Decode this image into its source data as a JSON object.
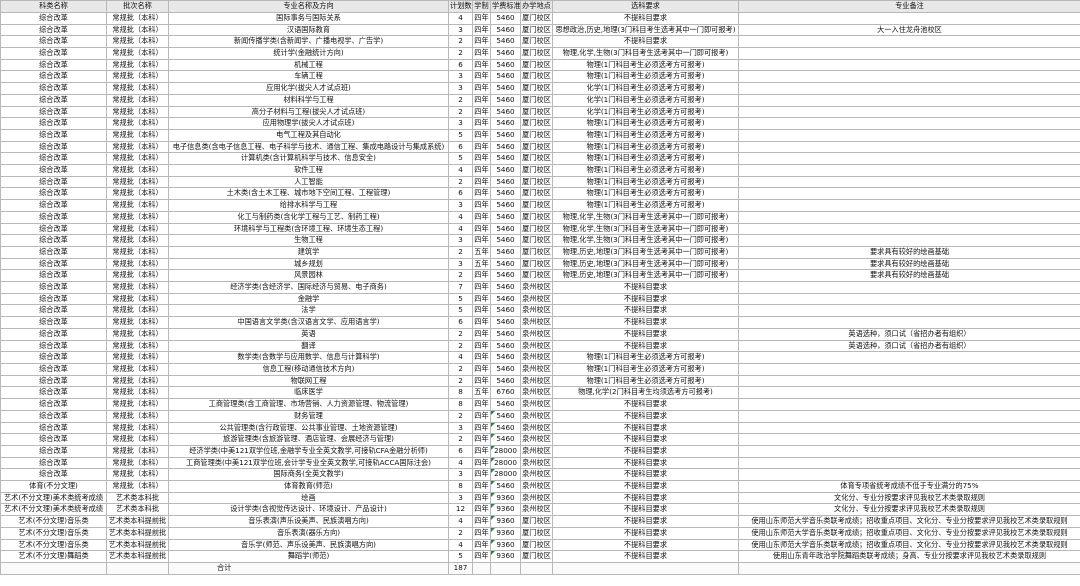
{
  "headers": [
    "科类名称",
    "批次名称",
    "专业名称及方向",
    "计划数",
    "学制",
    "学费标准",
    "办学地点",
    "选科要求",
    "专业备注"
  ],
  "rows": [
    [
      "综合改革",
      "常规批（本科）",
      "国际事务与国际关系",
      "4",
      "四年",
      "5460",
      "厦门校区",
      "不提科目要求",
      ""
    ],
    [
      "综合改革",
      "常规批（本科）",
      "汉语国际教育",
      "3",
      "四年",
      "5460",
      "厦门校区",
      "思想政治,历史,地理(3门科目考生选考其中一门即可报考)",
      "大一入住龙舟池校区"
    ],
    [
      "综合改革",
      "常规批（本科）",
      "新闻传播学类(含新闻学、广播电视学、广告学)",
      "2",
      "四年",
      "5460",
      "厦门校区",
      "不提科目要求",
      ""
    ],
    [
      "综合改革",
      "常规批（本科）",
      "统计学(金融统计方向)",
      "2",
      "四年",
      "5460",
      "厦门校区",
      "物理,化学,生物(3门科目考生选考其中一门即可报考)",
      ""
    ],
    [
      "综合改革",
      "常规批（本科）",
      "机械工程",
      "6",
      "四年",
      "5460",
      "厦门校区",
      "物理(1门科目考生必须选考方可报考)",
      ""
    ],
    [
      "综合改革",
      "常规批（本科）",
      "车辆工程",
      "3",
      "四年",
      "5460",
      "厦门校区",
      "物理(1门科目考生必须选考方可报考)",
      ""
    ],
    [
      "综合改革",
      "常规批（本科）",
      "应用化学(拔尖人才试点班)",
      "3",
      "四年",
      "5460",
      "厦门校区",
      "化学(1门科目考生必须选考方可报考)",
      ""
    ],
    [
      "综合改革",
      "常规批（本科）",
      "材料科学与工程",
      "2",
      "四年",
      "5460",
      "厦门校区",
      "化学(1门科目考生必须选考方可报考)",
      ""
    ],
    [
      "综合改革",
      "常规批（本科）",
      "高分子材料与工程(拔尖人才试点班)",
      "2",
      "四年",
      "5460",
      "厦门校区",
      "化学(1门科目考生必须选考方可报考)",
      ""
    ],
    [
      "综合改革",
      "常规批（本科）",
      "应用物理学(拔尖人才试点班)",
      "3",
      "四年",
      "5460",
      "厦门校区",
      "物理(1门科目考生必须选考方可报考)",
      ""
    ],
    [
      "综合改革",
      "常规批（本科）",
      "电气工程及其自动化",
      "5",
      "四年",
      "5460",
      "厦门校区",
      "物理(1门科目考生必须选考方可报考)",
      ""
    ],
    [
      "综合改革",
      "常规批（本科）",
      "电子信息类(含电子信息工程、电子科学与技术、通信工程、集成电路设计与集成系统)",
      "6",
      "四年",
      "5460",
      "厦门校区",
      "物理(1门科目考生必须选考方可报考)",
      ""
    ],
    [
      "综合改革",
      "常规批（本科）",
      "计算机类(含计算机科学与技术、信息安全)",
      "5",
      "四年",
      "5460",
      "厦门校区",
      "物理(1门科目考生必须选考方可报考)",
      ""
    ],
    [
      "综合改革",
      "常规批（本科）",
      "软件工程",
      "4",
      "四年",
      "5460",
      "厦门校区",
      "物理(1门科目考生必须选考方可报考)",
      ""
    ],
    [
      "综合改革",
      "常规批（本科）",
      "人工智能",
      "2",
      "四年",
      "5460",
      "厦门校区",
      "物理(1门科目考生必须选考方可报考)",
      ""
    ],
    [
      "综合改革",
      "常规批（本科）",
      "土木类(含土木工程、城市地下空间工程、工程管理)",
      "6",
      "四年",
      "5460",
      "厦门校区",
      "物理(1门科目考生必须选考方可报考)",
      ""
    ],
    [
      "综合改革",
      "常规批（本科）",
      "给排水科学与工程",
      "3",
      "四年",
      "5460",
      "厦门校区",
      "物理(1门科目考生必须选考方可报考)",
      ""
    ],
    [
      "综合改革",
      "常规批（本科）",
      "化工与制药类(含化学工程与工艺、制药工程)",
      "4",
      "四年",
      "5460",
      "厦门校区",
      "物理,化学,生物(3门科目考生选考其中一门即可报考)",
      ""
    ],
    [
      "综合改革",
      "常规批（本科）",
      "环境科学与工程类(含环境工程、环境生态工程)",
      "4",
      "四年",
      "5460",
      "厦门校区",
      "物理,化学,生物(3门科目考生选考其中一门即可报考)",
      ""
    ],
    [
      "综合改革",
      "常规批（本科）",
      "生物工程",
      "3",
      "四年",
      "5460",
      "厦门校区",
      "物理,化学,生物(3门科目考生选考其中一门即可报考)",
      ""
    ],
    [
      "综合改革",
      "常规批（本科）",
      "建筑学",
      "2",
      "五年",
      "5460",
      "厦门校区",
      "物理,历史,地理(3门科目考生选考其中一门即可报考)",
      "要求具有较好的绘画基础"
    ],
    [
      "综合改革",
      "常规批（本科）",
      "城乡规划",
      "3",
      "五年",
      "5460",
      "厦门校区",
      "物理,历史,地理(3门科目考生选考其中一门即可报考)",
      "要求具有较好的绘画基础"
    ],
    [
      "综合改革",
      "常规批（本科）",
      "风景园林",
      "2",
      "四年",
      "5460",
      "厦门校区",
      "物理,历史,地理(3门科目考生选考其中一门即可报考)",
      "要求具有较好的绘画基础"
    ],
    [
      "综合改革",
      "常规批（本科）",
      "经济学类(含经济学、国际经济与贸易、电子商务)",
      "7",
      "四年",
      "5460",
      "泉州校区",
      "不提科目要求",
      ""
    ],
    [
      "综合改革",
      "常规批（本科）",
      "金融学",
      "5",
      "四年",
      "5460",
      "泉州校区",
      "不提科目要求",
      ""
    ],
    [
      "综合改革",
      "常规批（本科）",
      "法学",
      "5",
      "四年",
      "5460",
      "泉州校区",
      "不提科目要求",
      ""
    ],
    [
      "综合改革",
      "常规批（本科）",
      "中国语言文学类(含汉语言文学、应用语言学)",
      "6",
      "四年",
      "5460",
      "泉州校区",
      "不提科目要求",
      ""
    ],
    [
      "综合改革",
      "常规批（本科）",
      "英语",
      "2",
      "四年",
      "5460",
      "泉州校区",
      "不提科目要求",
      "英语选种，须口试（省招办者有组织）"
    ],
    [
      "综合改革",
      "常规批（本科）",
      "翻译",
      "2",
      "四年",
      "5460",
      "泉州校区",
      "不提科目要求",
      "英语选种，须口试（省招办者有组织）"
    ],
    [
      "综合改革",
      "常规批（本科）",
      "数学类(含数学与应用数学、信息与计算科学)",
      "4",
      "四年",
      "5460",
      "泉州校区",
      "物理(1门科目考生必须选考方可报考)",
      ""
    ],
    [
      "综合改革",
      "常规批（本科）",
      "信息工程(移动通信技术方向)",
      "2",
      "四年",
      "5460",
      "泉州校区",
      "物理(1门科目考生必须选考方可报考)",
      ""
    ],
    [
      "综合改革",
      "常规批（本科）",
      "物联网工程",
      "2",
      "四年",
      "5460",
      "泉州校区",
      "物理(1门科目考生必须选考方可报考)",
      ""
    ],
    [
      "综合改革",
      "常规批（本科）",
      "临床医学",
      "8",
      "五年",
      "6760",
      "泉州校区",
      "物理,化学(2门科目考生均须选考方可报考)",
      ""
    ],
    [
      "综合改革",
      "常规批（本科）",
      "工商管理类(含工商管理、市场营销、人力资源管理、物流管理)",
      "8",
      "四年",
      "5460",
      "泉州校区",
      "不提科目要求",
      ""
    ],
    [
      "综合改革",
      "常规批（本科）",
      "财务管理",
      "2",
      "四年",
      "5460",
      "泉州校区",
      "不提科目要求",
      ""
    ],
    [
      "综合改革",
      "常规批（本科）",
      "公共管理类(含行政管理、公共事业管理、土地资源管理)",
      "3",
      "四年",
      "5460",
      "泉州校区",
      "不提科目要求",
      ""
    ],
    [
      "综合改革",
      "常规批（本科）",
      "旅游管理类(含旅游管理、酒店管理、会展经济与管理)",
      "2",
      "四年",
      "5460",
      "泉州校区",
      "不提科目要求",
      ""
    ],
    [
      "综合改革",
      "常规批（本科）",
      "经济学类(中美121双学位班,金融学专业全英文教学,可接轨CFA金融分析师)",
      "6",
      "四年",
      "28000",
      "泉州校区",
      "不提科目要求",
      ""
    ],
    [
      "综合改革",
      "常规批（本科）",
      "工商管理类(中美121双学位班,会计学专业全英文教学,可接轨ACCA国际注会)",
      "4",
      "四年",
      "28000",
      "泉州校区",
      "不提科目要求",
      ""
    ],
    [
      "综合改革",
      "常规批（本科）",
      "国际商务(全英文教学)",
      "3",
      "四年",
      "28000",
      "泉州校区",
      "不提科目要求",
      ""
    ],
    [
      "体育(不分文理)",
      "常规批（本科）",
      "体育教育(师范)",
      "8",
      "四年",
      "5460",
      "泉州校区",
      "不提科目要求",
      "体育专项省统考成绩不低于专业满分的75%"
    ],
    [
      "艺术(不分文理)美术类统考成绩",
      "艺术类本科批",
      "绘画",
      "3",
      "四年",
      "9360",
      "泉州校区",
      "不提科目要求",
      "文化分、专业分按要求评见我校艺术类录取规则"
    ],
    [
      "艺术(不分文理)美术类统考成绩",
      "艺术类本科批",
      "设计学类(含视觉传达设计、环境设计、产品设计)",
      "12",
      "四年",
      "9360",
      "泉州校区",
      "不提科目要求",
      "文化分、专业分按要求评见我校艺术类录取规则"
    ],
    [
      "艺术(不分文理)音乐类",
      "艺术类本科提前批",
      "音乐表演(声乐设美声、民族演唱方向)",
      "4",
      "四年",
      "9360",
      "厦门校区",
      "不提科目要求",
      "使用山东师范大学音乐类联考成绩；招收重点项目、文化分、专业分按要求评见我校艺术类录取规则"
    ],
    [
      "艺术(不分文理)音乐类",
      "艺术类本科提前批",
      "音乐表演(器乐方向)",
      "2",
      "四年",
      "9360",
      "厦门校区",
      "不提科目要求",
      "使用山东师范大学音乐类联考成绩；招收重点项目、文化分、专业分按要求评见我校艺术类录取规则"
    ],
    [
      "艺术(不分文理)音乐类",
      "艺术类本科提前批",
      "音乐学(师范、声乐设美声、民族演唱方向)",
      "4",
      "四年",
      "9360",
      "厦门校区",
      "不提科目要求",
      "使用山东师范大学音乐类联考成绩；招收重点项目、文化分、专业分按要求评见我校艺术类录取规则"
    ],
    [
      "艺术(不分文理)舞蹈类",
      "艺术类本科提前批",
      "舞蹈学(师范)",
      "5",
      "四年",
      "9360",
      "厦门校区",
      "不提科目要求",
      "使用山东青年政治学院舞蹈类联考成绩；身高、专业分按要求评见我校艺术类录取规则"
    ]
  ],
  "footer": {
    "label": "合计",
    "total": "187"
  },
  "colors": {
    "header_bg": "#e8e8e8",
    "grid": "#b8b8b8",
    "comment_marker": "#1f8a3b"
  }
}
